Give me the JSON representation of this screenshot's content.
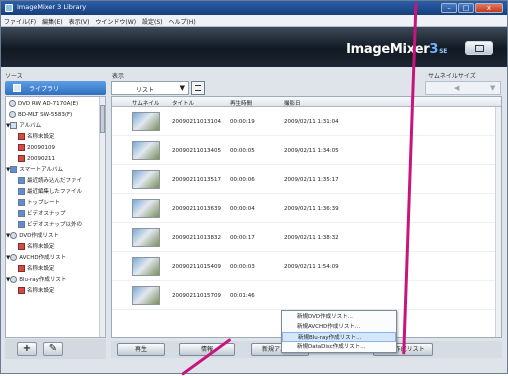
{
  "window": {
    "title": "ImageMixer 3 Library",
    "controls": [
      "–",
      "□",
      "x"
    ]
  },
  "menu": [
    "ファイル(F)",
    "編集(E)",
    "表示(V)",
    "ウインドウ(W)",
    "設定(S)",
    "ヘルプ(H)"
  ],
  "header": {
    "brand": "ImageMixer",
    "brand_num": "3",
    "brand_ed": "SE"
  },
  "panels": {
    "source": "ソース",
    "view": "表示",
    "thumb_size": "サムネイルサイズ"
  },
  "library_tab": "ライブラリ",
  "tree": [
    {
      "label": "DVD RW AD-7170A(E)",
      "icon": "disc"
    },
    {
      "label": "BD-MLT SW-5583(F)",
      "icon": "disc"
    },
    {
      "label": "アルバム",
      "icon": "folder",
      "expand": "▼"
    },
    {
      "label": "名称未設定",
      "icon": "red"
    },
    {
      "label": "20090109",
      "icon": "red"
    },
    {
      "label": "20090211",
      "icon": "red"
    },
    {
      "label": "スマートアルバム",
      "icon": "blue",
      "expand": "▼"
    },
    {
      "label": "最近読み込んだファイ",
      "icon": "blue"
    },
    {
      "label": "最近編集したファイル",
      "icon": "blue"
    },
    {
      "label": "トップレート",
      "icon": "blue"
    },
    {
      "label": "ビデオスナップ",
      "icon": "blue"
    },
    {
      "label": "ビデオスナップ以外の",
      "icon": "blue"
    },
    {
      "label": "DVD作成リスト",
      "icon": "disc",
      "expand": "▼"
    },
    {
      "label": "名称未設定",
      "icon": "red"
    },
    {
      "label": "AVCHD作成リスト",
      "icon": "disc",
      "expand": "▼"
    },
    {
      "label": "名称未設定",
      "icon": "red"
    },
    {
      "label": "Blu-ray作成リスト",
      "icon": "disc",
      "expand": "▼"
    },
    {
      "label": "名称未設定",
      "icon": "red"
    }
  ],
  "view": {
    "mode": "リスト",
    "arrow": "▼"
  },
  "slider": {
    "left": "◀",
    "right": "▼"
  },
  "columns": [
    "サムネイル",
    "タイトル",
    "再生時間",
    "撮影日"
  ],
  "rows": [
    {
      "title": "20090211013104",
      "duration": "00:00:19",
      "date": "2009/02/11 1:31:04"
    },
    {
      "title": "20090211013405",
      "duration": "00:00:05",
      "date": "2009/02/11 1:34:05"
    },
    {
      "title": "20090211013517",
      "duration": "00:00:06",
      "date": "2009/02/11 1:35:17"
    },
    {
      "title": "20090211013639",
      "duration": "00:00:04",
      "date": "2009/02/11 1:36:39"
    },
    {
      "title": "20090211013832",
      "duration": "00:00:17",
      "date": "2009/02/11 1:38:32"
    },
    {
      "title": "20090211015409",
      "duration": "00:00:03",
      "date": "2009/02/11 1:54:09"
    },
    {
      "title": "20090211015709",
      "duration": "00:01:46",
      "date": ""
    }
  ],
  "bottom_buttons": {
    "play": "再生",
    "info": "情報",
    "new_album": "新規アルバム",
    "new_list": "DVD作成リスト"
  },
  "context_menu": [
    "新規DVD作成リスト...",
    "新規AVCHD作成リスト...",
    "新規Blu-ray作成リスト...",
    "新規DataDisc作成リスト..."
  ],
  "side_buttons": {
    "add": "+",
    "tools": "✎"
  },
  "colors": {
    "accent": "#c8157e",
    "header": "#111922",
    "selection": "#d4e6fb"
  }
}
